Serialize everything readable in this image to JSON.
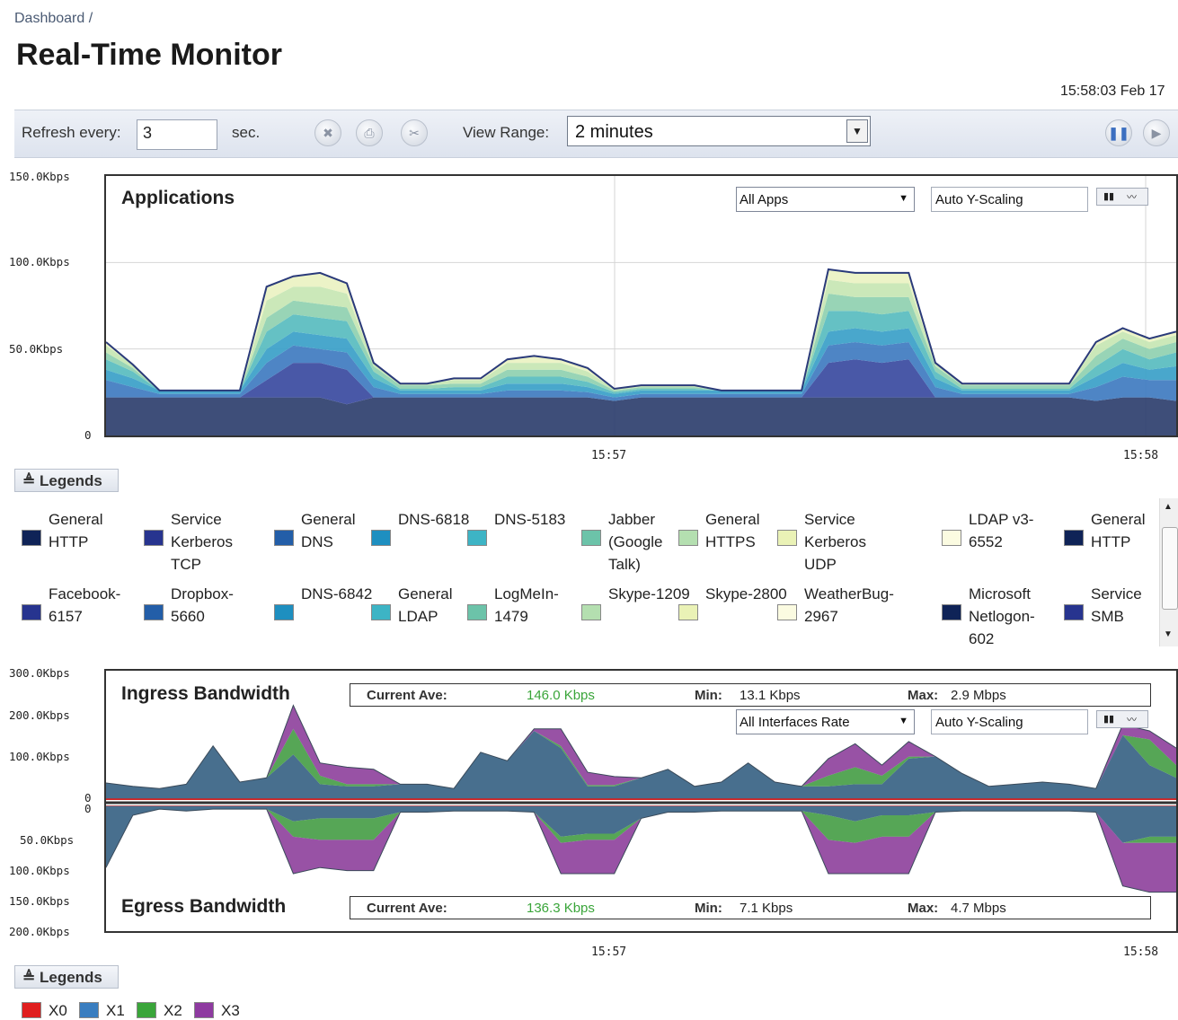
{
  "breadcrumb": "Dashboard /",
  "page_title": "Real-Time Monitor",
  "datetime": "15:58:03 Feb 17",
  "toolbar": {
    "refresh_label": "Refresh every:",
    "refresh_value": "3",
    "sec_label": "sec.",
    "view_range_label": "View Range:",
    "view_range_value": "2 minutes",
    "icons": [
      "delete-icon",
      "print-icon",
      "settings-icon",
      "pause-icon",
      "play-icon"
    ]
  },
  "applications_chart": {
    "title": "Applications",
    "filter": "All Apps",
    "scaling": "Auto Y-Scaling",
    "y_ticks": [
      "150.0Kbps",
      "100.0Kbps",
      "50.0Kbps",
      "0"
    ],
    "x_ticks": [
      "15:57",
      "15:58"
    ]
  },
  "applications_legend": {
    "button": "Legends",
    "items": [
      {
        "label": "General HTTP",
        "color": "#0f2357"
      },
      {
        "label": "Service Kerberos TCP",
        "color": "#27348f"
      },
      {
        "label": "General DNS",
        "color": "#235ea8"
      },
      {
        "label": "DNS-6818",
        "color": "#1e8fc0"
      },
      {
        "label": "DNS-5183",
        "color": "#3db4c5"
      },
      {
        "label": "Jabber (Google Talk)",
        "color": "#6cc3a9"
      },
      {
        "label": "General HTTPS",
        "color": "#b4dfb0"
      },
      {
        "label": "Service Kerberos UDP",
        "color": "#eaf2b6"
      },
      {
        "label": "LDAP v3-6552",
        "color": "#fbfbe1"
      },
      {
        "label": "General HTTP",
        "color": "#0f2357"
      },
      {
        "label": "Facebook-6157",
        "color": "#27348f"
      },
      {
        "label": "Dropbox-5660",
        "color": "#235ea8"
      },
      {
        "label": "DNS-6842",
        "color": "#1e8fc0"
      },
      {
        "label": "General LDAP",
        "color": "#3db4c5"
      },
      {
        "label": "LogMeIn-1479",
        "color": "#6cc3a9"
      },
      {
        "label": "Skype-1209",
        "color": "#b4dfb0"
      },
      {
        "label": "Skype-2800",
        "color": "#eaf2b6"
      },
      {
        "label": "WeatherBug-2967",
        "color": "#fbfbe1"
      },
      {
        "label": "Microsoft Netlogon-602",
        "color": "#0f2357"
      },
      {
        "label": "Service SMB",
        "color": "#27348f"
      }
    ]
  },
  "bandwidth_chart": {
    "ingress_title": "Ingress Bandwidth",
    "egress_title": "Egress Bandwidth",
    "interface_filter": "All Interfaces Rate",
    "scaling": "Auto Y-Scaling",
    "ingress_y_ticks": [
      "300.0Kbps",
      "200.0Kbps",
      "100.0Kbps",
      "0"
    ],
    "egress_y_ticks": [
      "0",
      "50.0Kbps",
      "100.0Kbps",
      "150.0Kbps",
      "200.0Kbps"
    ],
    "x_ticks": [
      "15:57",
      "15:58"
    ],
    "ingress_stats": {
      "current_label": "Current Ave:",
      "current": "146.0 Kbps",
      "min_label": "Min:",
      "min": "13.1 Kbps",
      "max_label": "Max:",
      "max": "2.9 Mbps"
    },
    "egress_stats": {
      "current_label": "Current Ave:",
      "current": "136.3 Kbps",
      "min_label": "Min:",
      "min": "7.1 Kbps",
      "max_label": "Max:",
      "max": "4.7 Mbps"
    }
  },
  "bandwidth_legend": {
    "button": "Legends",
    "items": [
      {
        "label": "X0",
        "color": "#e01e1e"
      },
      {
        "label": "X1",
        "color": "#3a7ec0"
      },
      {
        "label": "X2",
        "color": "#3aa53a"
      },
      {
        "label": "X3",
        "color": "#8e3aa0"
      }
    ]
  },
  "chart_data": [
    {
      "type": "area",
      "title": "Applications",
      "ylim": [
        0,
        150
      ],
      "x_ticks": [
        "15:57",
        "15:58"
      ],
      "x": [
        0,
        1,
        2,
        3,
        4,
        5,
        6,
        7,
        8,
        9,
        10,
        11,
        12,
        13,
        14,
        15,
        16,
        17,
        18,
        19,
        20,
        21,
        22,
        23,
        24,
        25,
        26,
        27,
        28,
        29,
        30,
        31,
        32,
        33,
        34,
        35,
        36,
        37,
        38,
        39,
        40
      ],
      "series": [
        {
          "name": "General HTTP",
          "values": [
            22,
            22,
            22,
            22,
            22,
            22,
            22,
            22,
            22,
            18,
            22,
            22,
            22,
            22,
            22,
            22,
            22,
            22,
            22,
            20,
            22,
            22,
            22,
            22,
            22,
            22,
            22,
            22,
            22,
            22,
            22,
            22,
            22,
            22,
            22,
            22,
            22,
            20,
            22,
            22,
            20
          ]
        },
        {
          "name": "Service Kerberos TCP",
          "values": [
            0,
            0,
            0,
            0,
            0,
            0,
            10,
            20,
            20,
            20,
            0,
            0,
            0,
            0,
            0,
            0,
            0,
            0,
            0,
            0,
            0,
            0,
            0,
            0,
            0,
            0,
            0,
            20,
            22,
            20,
            22,
            0,
            0,
            0,
            0,
            0,
            0,
            0,
            0,
            0,
            0
          ]
        },
        {
          "name": "General DNS",
          "values": [
            10,
            6,
            2,
            2,
            2,
            2,
            10,
            10,
            8,
            10,
            6,
            2,
            2,
            2,
            2,
            4,
            4,
            4,
            3,
            2,
            2,
            2,
            2,
            2,
            2,
            2,
            2,
            10,
            10,
            10,
            10,
            6,
            2,
            2,
            2,
            2,
            2,
            8,
            12,
            10,
            12
          ]
        },
        {
          "name": "DNS-6818",
          "values": [
            6,
            5,
            2,
            2,
            2,
            2,
            8,
            8,
            8,
            8,
            5,
            2,
            2,
            2,
            2,
            4,
            4,
            4,
            3,
            2,
            2,
            2,
            2,
            2,
            2,
            2,
            2,
            8,
            8,
            8,
            8,
            5,
            2,
            2,
            2,
            2,
            2,
            6,
            8,
            6,
            8
          ]
        },
        {
          "name": "DNS-5183",
          "values": [
            6,
            4,
            0,
            0,
            0,
            0,
            10,
            10,
            10,
            10,
            4,
            1,
            1,
            2,
            2,
            4,
            4,
            4,
            3,
            1,
            1,
            1,
            1,
            0,
            0,
            0,
            0,
            12,
            10,
            10,
            10,
            4,
            1,
            1,
            1,
            1,
            1,
            6,
            8,
            6,
            8
          ]
        },
        {
          "name": "Jabber (Google Talk)",
          "values": [
            4,
            2,
            0,
            0,
            0,
            0,
            8,
            8,
            8,
            8,
            3,
            2,
            2,
            2,
            2,
            4,
            4,
            4,
            3,
            1,
            1,
            1,
            1,
            0,
            0,
            0,
            0,
            10,
            8,
            10,
            8,
            3,
            2,
            2,
            2,
            2,
            2,
            6,
            6,
            6,
            6
          ]
        },
        {
          "name": "General HTTPS",
          "values": [
            4,
            2,
            0,
            0,
            0,
            0,
            10,
            8,
            10,
            8,
            2,
            1,
            1,
            2,
            2,
            4,
            4,
            4,
            3,
            1,
            1,
            1,
            1,
            0,
            0,
            0,
            0,
            8,
            8,
            8,
            8,
            2,
            1,
            1,
            1,
            1,
            1,
            6,
            4,
            4,
            4
          ]
        },
        {
          "name": "Service Kerberos UDP",
          "values": [
            2,
            0,
            0,
            0,
            0,
            0,
            8,
            6,
            8,
            6,
            0,
            0,
            0,
            1,
            1,
            2,
            4,
            2,
            2,
            0,
            0,
            0,
            0,
            0,
            0,
            0,
            0,
            6,
            6,
            6,
            6,
            0,
            0,
            0,
            0,
            0,
            0,
            2,
            2,
            2,
            2
          ]
        }
      ]
    },
    {
      "type": "area",
      "title": "Ingress Bandwidth",
      "ylim": [
        0,
        300
      ],
      "x_ticks": [
        "15:57",
        "15:58"
      ],
      "x": [
        0,
        1,
        2,
        3,
        4,
        5,
        6,
        7,
        8,
        9,
        10,
        11,
        12,
        13,
        14,
        15,
        16,
        17,
        18,
        19,
        20,
        21,
        22,
        23,
        24,
        25,
        26,
        27,
        28,
        29,
        30,
        31,
        32,
        33,
        34,
        35,
        36,
        37,
        38,
        39,
        40
      ],
      "series": [
        {
          "name": "X0",
          "values": [
            2,
            2,
            2,
            2,
            2,
            2,
            2,
            2,
            2,
            2,
            2,
            2,
            2,
            2,
            2,
            2,
            2,
            2,
            2,
            2,
            2,
            2,
            2,
            2,
            2,
            2,
            2,
            2,
            2,
            2,
            2,
            2,
            2,
            2,
            2,
            2,
            2,
            2,
            2,
            2,
            2
          ]
        },
        {
          "name": "X1",
          "values": [
            38,
            30,
            25,
            35,
            125,
            40,
            50,
            105,
            35,
            30,
            30,
            35,
            35,
            25,
            110,
            90,
            160,
            120,
            30,
            30,
            50,
            70,
            30,
            40,
            85,
            40,
            30,
            30,
            35,
            35,
            95,
            100,
            60,
            30,
            35,
            40,
            35,
            25,
            150,
            80,
            50
          ]
        },
        {
          "name": "X2",
          "values": [
            0,
            0,
            0,
            0,
            0,
            0,
            0,
            60,
            20,
            5,
            5,
            0,
            0,
            0,
            0,
            0,
            0,
            5,
            3,
            3,
            0,
            0,
            0,
            0,
            0,
            0,
            0,
            25,
            40,
            20,
            5,
            0,
            0,
            0,
            0,
            0,
            0,
            0,
            0,
            60,
            30
          ]
        },
        {
          "name": "X3",
          "values": [
            0,
            0,
            0,
            0,
            0,
            0,
            0,
            55,
            30,
            40,
            35,
            0,
            0,
            0,
            0,
            0,
            5,
            40,
            30,
            20,
            0,
            0,
            0,
            0,
            0,
            0,
            0,
            40,
            55,
            25,
            35,
            0,
            0,
            0,
            0,
            0,
            0,
            0,
            25,
            20,
            40
          ]
        }
      ]
    },
    {
      "type": "area",
      "title": "Egress Bandwidth",
      "ylim": [
        0,
        200
      ],
      "x_ticks": [
        "15:57",
        "15:58"
      ],
      "x": [
        0,
        1,
        2,
        3,
        4,
        5,
        6,
        7,
        8,
        9,
        10,
        11,
        12,
        13,
        14,
        15,
        16,
        17,
        18,
        19,
        20,
        21,
        22,
        23,
        24,
        25,
        26,
        27,
        28,
        29,
        30,
        31,
        32,
        33,
        34,
        35,
        36,
        37,
        38,
        39,
        40
      ],
      "series": [
        {
          "name": "X0",
          "values": [
            1,
            1,
            1,
            1,
            1,
            1,
            1,
            1,
            1,
            1,
            1,
            1,
            1,
            1,
            1,
            1,
            1,
            1,
            1,
            1,
            1,
            1,
            1,
            1,
            1,
            1,
            1,
            1,
            1,
            1,
            1,
            1,
            1,
            1,
            1,
            1,
            1,
            1,
            1,
            1,
            1
          ]
        },
        {
          "name": "X1",
          "values": [
            100,
            15,
            5,
            8,
            5,
            5,
            5,
            25,
            20,
            20,
            20,
            10,
            10,
            8,
            8,
            8,
            10,
            50,
            45,
            45,
            20,
            10,
            10,
            8,
            8,
            8,
            8,
            15,
            25,
            15,
            15,
            10,
            8,
            8,
            8,
            8,
            8,
            10,
            60,
            50,
            50
          ]
        },
        {
          "name": "X2",
          "values": [
            0,
            0,
            0,
            0,
            0,
            0,
            0,
            25,
            35,
            35,
            35,
            0,
            0,
            0,
            0,
            0,
            0,
            10,
            10,
            10,
            0,
            0,
            0,
            0,
            0,
            0,
            0,
            40,
            35,
            35,
            35,
            0,
            0,
            0,
            0,
            0,
            0,
            0,
            0,
            10,
            10
          ]
        },
        {
          "name": "X3",
          "values": [
            0,
            0,
            0,
            0,
            0,
            0,
            0,
            60,
            45,
            50,
            50,
            0,
            0,
            0,
            0,
            0,
            0,
            50,
            55,
            55,
            0,
            0,
            0,
            0,
            0,
            0,
            0,
            55,
            50,
            60,
            60,
            0,
            0,
            0,
            0,
            0,
            0,
            0,
            70,
            80,
            80
          ]
        }
      ]
    }
  ]
}
